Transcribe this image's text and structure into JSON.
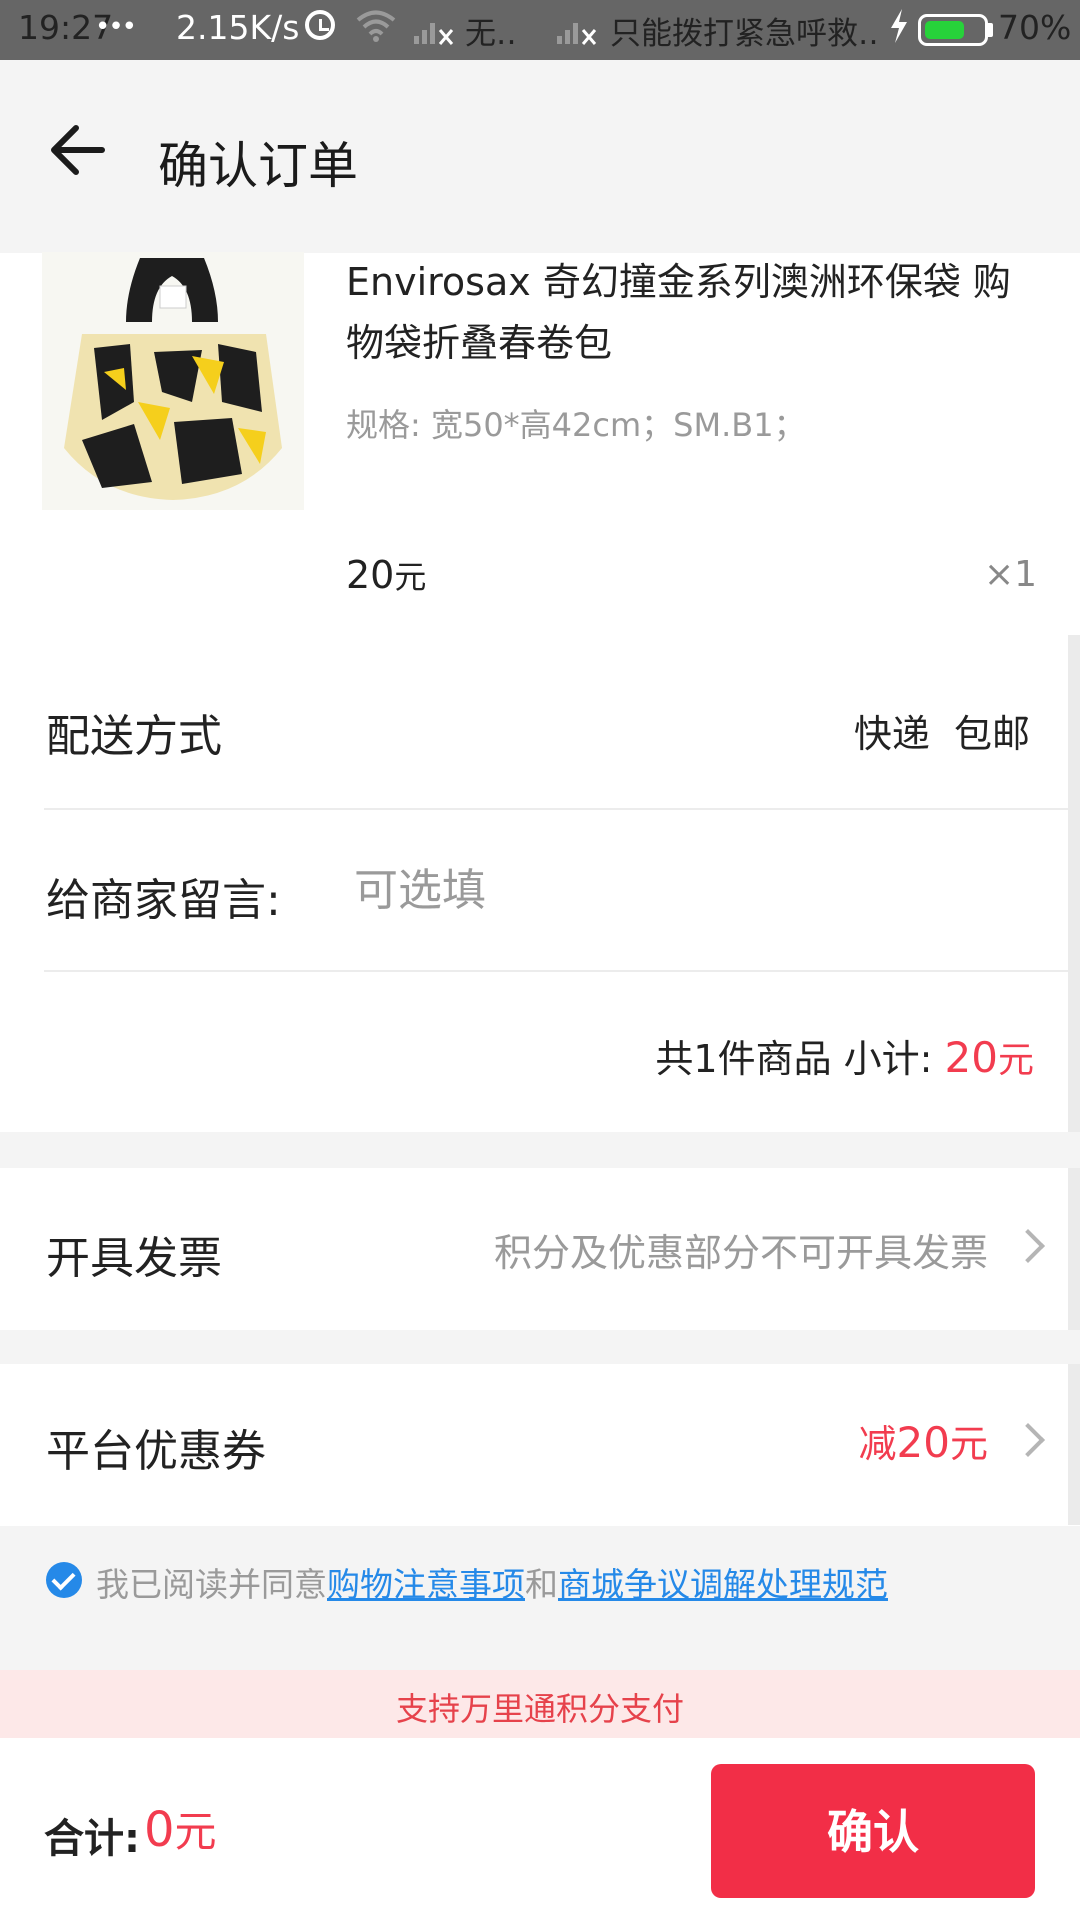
{
  "status_bar": {
    "time": "19:27",
    "dots": "•••",
    "speed": "2.15K/s",
    "carrier1": "无‥",
    "carrier2": "只能拨打紧急呼救‥",
    "battery_percent": "70%",
    "battery_level": 0.7,
    "battery_color": "#27d23a"
  },
  "header": {
    "title": "确认订单",
    "back_icon": "back-arrow-icon"
  },
  "product": {
    "title": "Envirosax 奇幻撞金系列澳洲环保袋 购物袋折叠春卷包",
    "spec": "规格: 宽50*高42cm；SM.B1；",
    "price": "20",
    "price_unit": "元",
    "quantity": "×1"
  },
  "delivery": {
    "label": "配送方式",
    "value": "快递  包邮"
  },
  "message": {
    "label": "给商家留言:",
    "placeholder": "可选填"
  },
  "subtotal": {
    "text": "共1件商品 小计: ",
    "amount": "20",
    "unit": "元"
  },
  "invoice": {
    "label": "开具发票",
    "note": "积分及优惠部分不可开具发票"
  },
  "coupon": {
    "label": "平台优惠券",
    "prefix": "减",
    "amount": "20",
    "unit": "元"
  },
  "agreement": {
    "prefix": "我已阅读并同意",
    "link1": "购物注意事项",
    "middle": "和",
    "link2": "商城争议调解处理规范"
  },
  "banner": {
    "text": "支持万里通积分支付"
  },
  "footer": {
    "total_label": "合计:",
    "total_amount": "0",
    "total_unit": "元",
    "confirm_label": "确认"
  },
  "colors": {
    "accent_red": "#f22e47",
    "price_red": "#f23c4f",
    "link_blue": "#2589e8",
    "banner_bg": "#fde8e8"
  }
}
